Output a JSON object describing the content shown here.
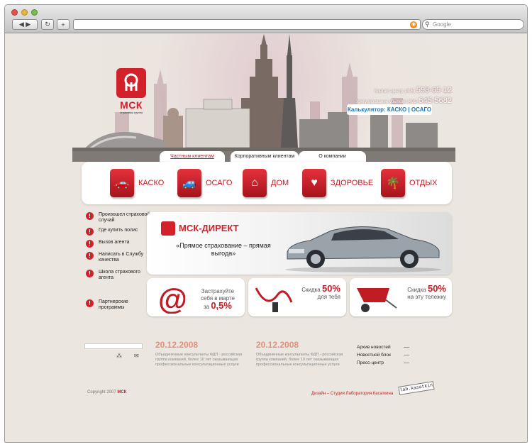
{
  "browser": {
    "search_placeholder": "Google",
    "back_icon": "◀ ▶",
    "reload_icon": "↻",
    "add_icon": "+",
    "rss_icon": "rss-icon"
  },
  "colors": {
    "brand_red": "#d3212b",
    "accent_blue": "#1b74b5",
    "date_color": "#e1907e"
  },
  "header": {
    "logo_text": "МСК",
    "logo_tagline": "страховая группа",
    "contact_label": "Контакт-центр:",
    "contact_code": "(495)",
    "contact_number": "598-65-12",
    "claims_label": "Урегулирование убытков:",
    "claims_code": "(495)",
    "claims_number": "545-5682",
    "calculator": "Калькулятор: КАСКО | ОСАГО"
  },
  "tabs": [
    {
      "label": "Частным клиентам"
    },
    {
      "label": "Корпоративным клиентам"
    },
    {
      "label": "О компании"
    }
  ],
  "services": [
    {
      "label": "КАСКО",
      "icon": "car-crash-icon"
    },
    {
      "label": "ОСАГО",
      "icon": "car-collision-icon"
    },
    {
      "label": "ДОМ",
      "icon": "house-icon"
    },
    {
      "label": "ЗДОРОВЬЕ",
      "icon": "heart-icon"
    },
    {
      "label": "ОТДЫХ",
      "icon": "palm-icon"
    }
  ],
  "left_menu": [
    {
      "label": "Произошел страховой случай"
    },
    {
      "label": "Где купить полис"
    },
    {
      "label": "Вызов агента"
    },
    {
      "label": "Написать в Службу качества"
    },
    {
      "label": "Школа страхового агента"
    },
    {
      "label": "Партнерские программы"
    }
  ],
  "banner": {
    "title": "МСК-ДИРЕКТ",
    "slogan": "«Прямое страхование – прямая выгода»"
  },
  "promos": [
    {
      "line1": "Застрахуйте",
      "line2": "себя в марте",
      "line3": "за",
      "value": "0,5%"
    },
    {
      "line1": "Скидка",
      "value": "50%",
      "line2": "для тебя"
    },
    {
      "line1": "Скидка",
      "value": "50%",
      "line2": "на эту тележку"
    }
  ],
  "news": [
    {
      "date": "20.12.2008",
      "text": "Объединенные консультанты ФДП - российская группа компаний, более 10 лет оказывающая профессиональные консультационные услуги"
    },
    {
      "date": "20.12.2008",
      "text": "Объединенные консультанты ФДП - российская группа компаний, более 10 лет оказывающая профессиональные консультационные услуги"
    }
  ],
  "right_links": [
    {
      "label": "Архив новостей"
    },
    {
      "label": "Новостной блок"
    },
    {
      "label": "Пресс-центр"
    }
  ],
  "footer": {
    "copyright": "Copyright 2007",
    "copyright_brand": "МСК",
    "design": "Дизайн – Студия Лаборатория Касаткина",
    "lab_badge": "lab.kasatkin"
  }
}
